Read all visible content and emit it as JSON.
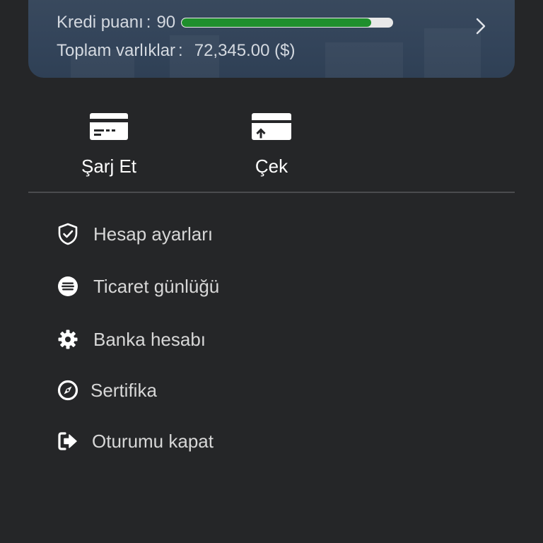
{
  "account": {
    "credit_label": "Kredi puanı",
    "credit_sep": ":",
    "credit_value": "90",
    "credit_progress": 0.9,
    "assets_label": "Toplam varlıklar",
    "assets_sep": ":",
    "assets_value": "72,345.00 ($)"
  },
  "actions": {
    "charge_label": "Şarj Et",
    "withdraw_label": "Çek"
  },
  "menu": {
    "items": [
      {
        "label": "Hesap ayarları",
        "icon": "shield-check-icon"
      },
      {
        "label": "Ticaret günlüğü",
        "icon": "list-circle-icon"
      },
      {
        "label": "Banka hesabı",
        "icon": "gear-icon"
      },
      {
        "label": "Sertifika",
        "icon": "compass-icon"
      },
      {
        "label": "Oturumu kapat",
        "icon": "logout-icon"
      }
    ]
  },
  "colors": {
    "background": "#252628",
    "card": "#33445a",
    "progress_fill": "#1f8f2d",
    "text": "#d7d7d7"
  }
}
